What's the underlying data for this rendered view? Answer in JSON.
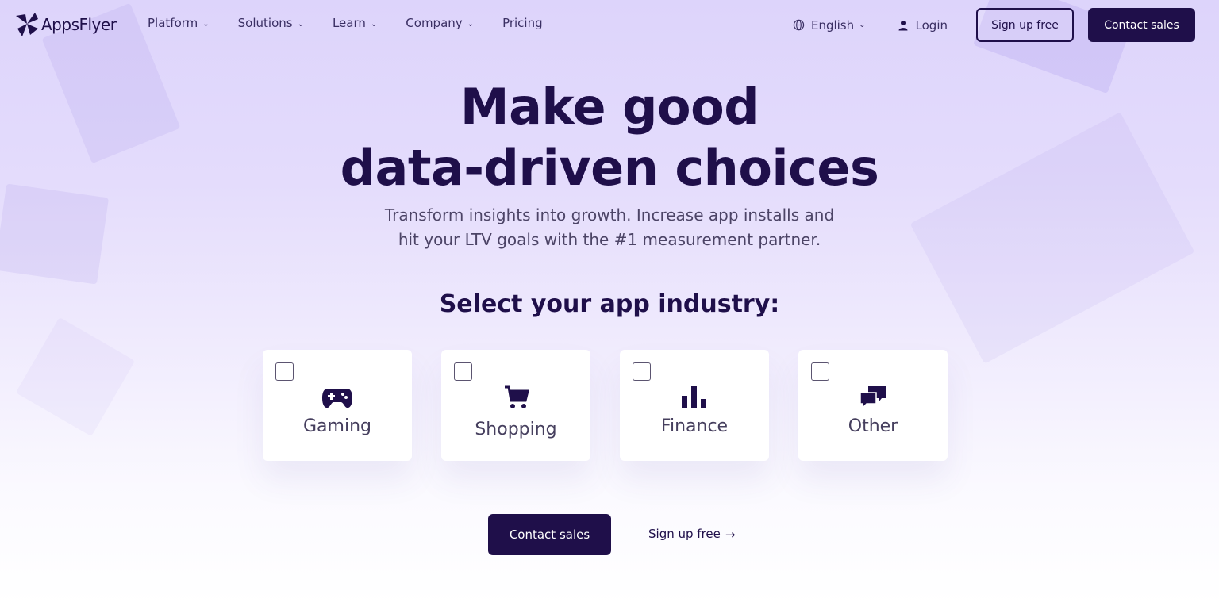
{
  "header": {
    "logo_text": "AppsFlyer",
    "menu": [
      {
        "label": "Platform",
        "has_dropdown": true
      },
      {
        "label": "Solutions",
        "has_dropdown": true
      },
      {
        "label": "Learn",
        "has_dropdown": true
      },
      {
        "label": "Company",
        "has_dropdown": true
      },
      {
        "label": "Pricing",
        "has_dropdown": false
      }
    ],
    "language": "English",
    "login_label": "Login",
    "signup_label": "Sign up free",
    "contact_label": "Contact sales"
  },
  "hero": {
    "title_line1": "Make good",
    "title_line2": "data-driven choices",
    "subtitle_line1": "Transform insights into growth. Increase app installs and",
    "subtitle_line2": "hit your LTV goals with the #1 measurement partner."
  },
  "industry": {
    "heading": "Select your app industry:",
    "options": [
      {
        "label": "Gaming",
        "icon": "gamepad-icon",
        "checked": false
      },
      {
        "label": "Shopping",
        "icon": "shopping-cart-icon",
        "checked": false
      },
      {
        "label": "Finance",
        "icon": "bar-chart-icon",
        "checked": false
      },
      {
        "label": "Other",
        "icon": "chat-bubbles-icon",
        "checked": false
      }
    ]
  },
  "cta": {
    "contact_label": "Contact sales",
    "signup_link": "Sign up free",
    "arrow": "→"
  },
  "colors": {
    "brand_dark": "#1f0f4a",
    "text_muted": "#4c4466",
    "background_top": "#ddd4fb"
  }
}
